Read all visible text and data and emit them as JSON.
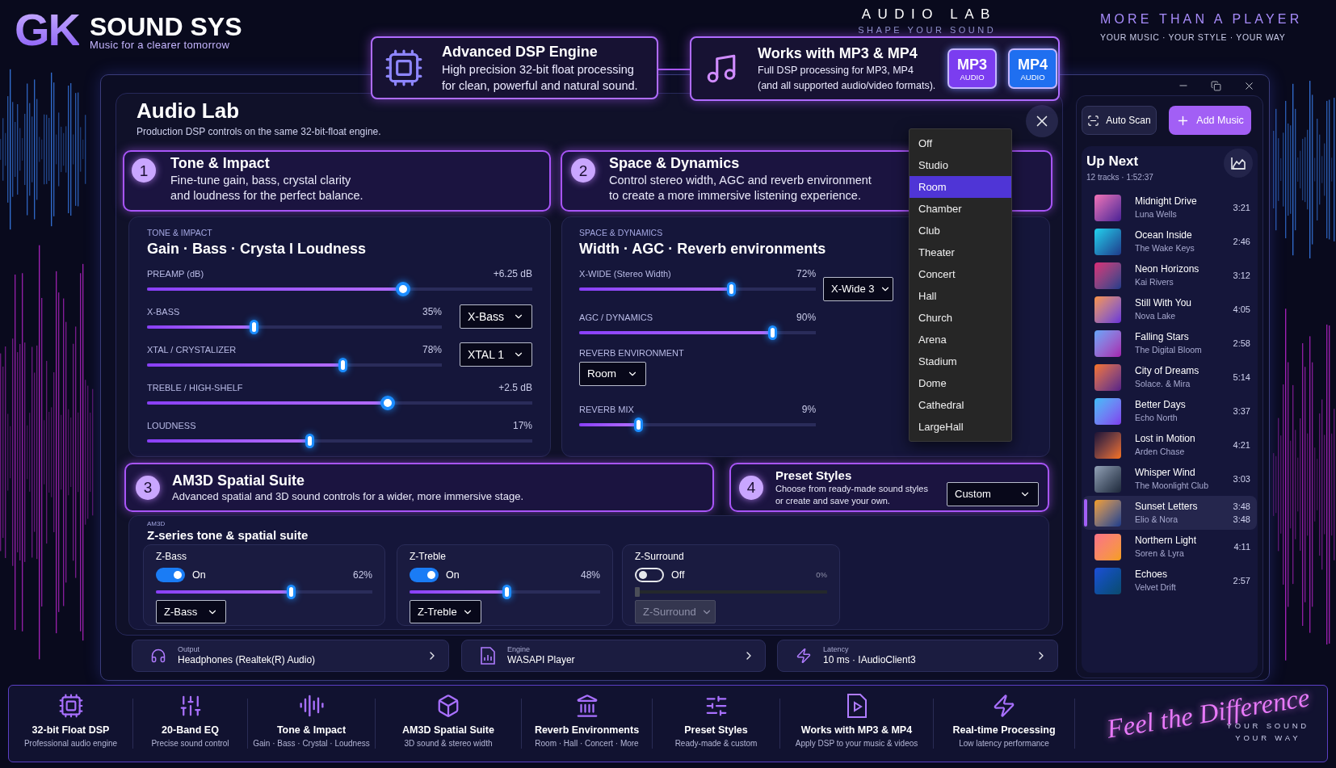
{
  "brand": {
    "logo": "GK",
    "name": "SOUND SYS",
    "tagline": "Music for a clearer tomorrow"
  },
  "header_center": {
    "title": "AUDIO LAB",
    "subtitle": "SHAPE YOUR SOUND"
  },
  "header_right": {
    "title": "MORE THAN A PLAYER",
    "subtitle": "YOUR MUSIC · YOUR STYLE · YOUR WAY"
  },
  "highlights": [
    {
      "kind": "dsp",
      "title": "Advanced DSP Engine",
      "lines": [
        "High precision 32-bit float processing",
        "for clean, powerful and natural sound."
      ]
    },
    {
      "kind": "formats",
      "title": "Works with MP3 & MP4",
      "lines": [
        "Full DSP processing for MP3, MP4",
        "(and all supported audio/video formats)."
      ],
      "badges": [
        {
          "label": "MP3",
          "sub": "AUDIO",
          "color": "#7b3df0"
        },
        {
          "label": "MP4",
          "sub": "AUDIO",
          "color": "#1f6ff0"
        }
      ]
    }
  ],
  "audio_lab": {
    "title": "Audio Lab",
    "subtitle": "Production DSP controls on the same 32-bit-float engine.",
    "tone": {
      "number": "1",
      "title": "Tone & Impact",
      "lines": [
        "Fine-tune gain, bass, crystal clarity",
        "and loudness for the perfect balance."
      ],
      "eyebrow": "TONE & IMPACT",
      "heading": "Gain · Bass · Crysta l Loudness",
      "controls": [
        {
          "kind": "gain",
          "label": "PREAMP (dB)",
          "reading": "+6.25 dB",
          "level": 0.67
        },
        {
          "kind": "slider",
          "label": "X-BASS",
          "reading": "35%",
          "level": 0.36,
          "select": "X-Bass"
        },
        {
          "kind": "slider",
          "label": "XTAL / CRYSTALIZER",
          "reading": "78%",
          "level": 0.67,
          "select": "XTAL 1"
        },
        {
          "kind": "gain",
          "label": "TREBLE / HIGH-SHELF",
          "reading": "+2.5 dB",
          "level": 0.63
        },
        {
          "kind": "slider",
          "label": "LOUDNESS",
          "reading": "17%",
          "level": 0.42
        }
      ]
    },
    "space": {
      "number": "2",
      "title": "Space & Dynamics",
      "lines": [
        "Control stereo width, AGC and reverb environment",
        "to create a more immersive listening experience."
      ],
      "eyebrow": "SPACE & DYNAMICS",
      "heading": "Width · AGC · Reverb environments",
      "controls": [
        {
          "kind": "slider",
          "label": "X-WIDE (Stereo Width)",
          "reading": "72%",
          "level": 0.65,
          "select": "X-Wide 3"
        },
        {
          "kind": "slider",
          "label": "AGC / DYNAMICS",
          "reading": "90%",
          "level": 0.83
        },
        {
          "kind": "select",
          "label": "REVERB ENVIRONMENT",
          "select": "Room"
        },
        {
          "kind": "slider",
          "label": "REVERB MIX",
          "reading": "9%",
          "level": 0.24
        }
      ],
      "reverb_menu": [
        {
          "label": "Off",
          "selected": false
        },
        {
          "label": "Studio",
          "selected": false
        },
        {
          "label": "Room",
          "selected": true
        },
        {
          "label": "Chamber",
          "selected": false
        },
        {
          "label": "Club",
          "selected": false
        },
        {
          "label": "Theater",
          "selected": false
        },
        {
          "label": "Concert",
          "selected": false
        },
        {
          "label": "Hall",
          "selected": false
        },
        {
          "label": "Church",
          "selected": false
        },
        {
          "label": "Arena",
          "selected": false
        },
        {
          "label": "Stadium",
          "selected": false
        },
        {
          "label": "Dome",
          "selected": false
        },
        {
          "label": "Cathedral",
          "selected": false
        },
        {
          "label": "LargeHall",
          "selected": false
        }
      ]
    },
    "spatial": {
      "number": "3",
      "title": "AM3D Spatial Suite",
      "lines": [
        "Advanced spatial and 3D sound controls for a wider, more immersive stage."
      ],
      "eyebrow": "AM3D",
      "heading": "Z-series tone & spatial suite",
      "modules": [
        {
          "name": "Z-Bass",
          "on": true,
          "state": "On",
          "reading": "62%",
          "level": 0.63,
          "select": "Z-Bass",
          "disabled": false
        },
        {
          "name": "Z-Treble",
          "on": true,
          "state": "On",
          "reading": "48%",
          "level": 0.51,
          "select": "Z-Treble",
          "disabled": false
        },
        {
          "name": "Z-Surround",
          "on": false,
          "state": "Off",
          "reading": "0%",
          "level": 0,
          "select": "Z-Surround",
          "disabled": true
        }
      ]
    },
    "presets": {
      "number": "4",
      "title": "Preset Styles",
      "lines": [
        "Choose from ready-made sound styles",
        "or create and save your own."
      ],
      "select": "Custom"
    }
  },
  "status": [
    {
      "kind": "output",
      "label": "Output",
      "value": "Headphones (Realtek(R) Audio)"
    },
    {
      "kind": "engine",
      "label": "Engine",
      "value": "WASAPI Player"
    },
    {
      "kind": "latency",
      "label": "Latency",
      "value": "10 ms · IAudioClient3"
    }
  ],
  "playlist": {
    "actions": [
      {
        "kind": "scan",
        "label": "Auto Scan"
      },
      {
        "kind": "add",
        "label": "Add Music"
      }
    ],
    "title": "Up Next",
    "summary": "12 tracks · 1:52:37",
    "tracks": [
      {
        "title": "Midnight Drive",
        "artist": "Luna Wells",
        "duration": "3:21",
        "selected": false
      },
      {
        "title": "Ocean Inside",
        "artist": "The Wake Keys",
        "duration": "2:46",
        "selected": false
      },
      {
        "title": "Neon Horizons",
        "artist": "Kai Rivers",
        "duration": "3:12",
        "selected": false
      },
      {
        "title": "Still With You",
        "artist": "Nova Lake",
        "duration": "4:05",
        "selected": false
      },
      {
        "title": "Falling Stars",
        "artist": "The Digital Bloom",
        "duration": "2:58",
        "selected": false
      },
      {
        "title": "City of Dreams",
        "artist": "Solace. & Mira",
        "duration": "5:14",
        "selected": false
      },
      {
        "title": "Better Days",
        "artist": "Echo North",
        "duration": "3:37",
        "selected": false
      },
      {
        "title": "Lost in Motion",
        "artist": "Arden Chase",
        "duration": "4:21",
        "selected": false
      },
      {
        "title": "Whisper Wind",
        "artist": "The Moonlight Club",
        "duration": "3:03",
        "selected": false
      },
      {
        "title": "Sunset Letters",
        "artist": "Elio & Nora",
        "duration": "3:48",
        "position": "3:48",
        "selected": true
      },
      {
        "title": "Northern Light",
        "artist": "Soren & Lyra",
        "duration": "4:11",
        "selected": false
      },
      {
        "title": "Echoes",
        "artist": "Velvet Drift",
        "duration": "2:57",
        "selected": false
      }
    ]
  },
  "features": [
    {
      "kind": "chip",
      "title": "32-bit Float DSP",
      "subtitle": "Professional audio engine"
    },
    {
      "kind": "eq",
      "title": "20-Band EQ",
      "subtitle": "Precise sound control"
    },
    {
      "kind": "wave",
      "title": "Tone & Impact",
      "subtitle": "Gain · Bass · Crystal · Loudness"
    },
    {
      "kind": "cube",
      "title": "AM3D Spatial Suite",
      "subtitle": "3D sound & stereo width"
    },
    {
      "kind": "venue",
      "title": "Reverb Environments",
      "subtitle": "Room · Hall · Concert · More"
    },
    {
      "kind": "presets",
      "title": "Preset Styles",
      "subtitle": "Ready-made & custom"
    },
    {
      "kind": "file",
      "title": "Works with MP3 & MP4",
      "subtitle": "Apply DSP to your music & videos"
    },
    {
      "kind": "bolt",
      "title": "Real-time Processing",
      "subtitle": "Low latency performance"
    }
  ],
  "slogan": {
    "script": "Feel the Difference",
    "lines": [
      "YOUR SOUND",
      "YOUR WAY"
    ]
  }
}
